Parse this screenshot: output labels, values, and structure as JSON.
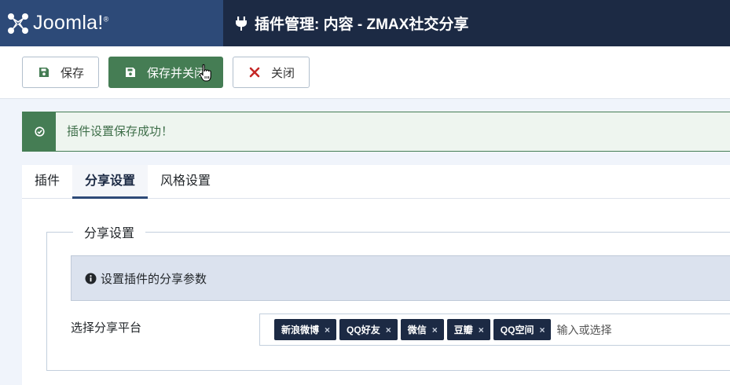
{
  "header": {
    "brand": "Joomla!",
    "brand_reg": "®",
    "title": "插件管理: 内容 - ZMAX社交分享"
  },
  "toolbar": {
    "save_label": "保存",
    "save_close_label": "保存并关闭",
    "close_label": "关闭"
  },
  "alert": {
    "message": "插件设置保存成功！"
  },
  "tabs": [
    {
      "label": "插件",
      "active": false
    },
    {
      "label": "分享设置",
      "active": true
    },
    {
      "label": "风格设置",
      "active": false
    }
  ],
  "panel": {
    "legend": "分享设置",
    "info": "设置插件的分享参数",
    "field_label": "选择分享平台",
    "tags": [
      "新浪微博",
      "QQ好友",
      "微信",
      "豆瓣",
      "QQ空间"
    ],
    "tag_remove": "×",
    "placeholder": "输入或选择"
  },
  "colors": {
    "header_bg": "#1c2a44",
    "brand_bg": "#2d4a78",
    "success": "#457d54",
    "tag_bg": "#1c2a44"
  }
}
